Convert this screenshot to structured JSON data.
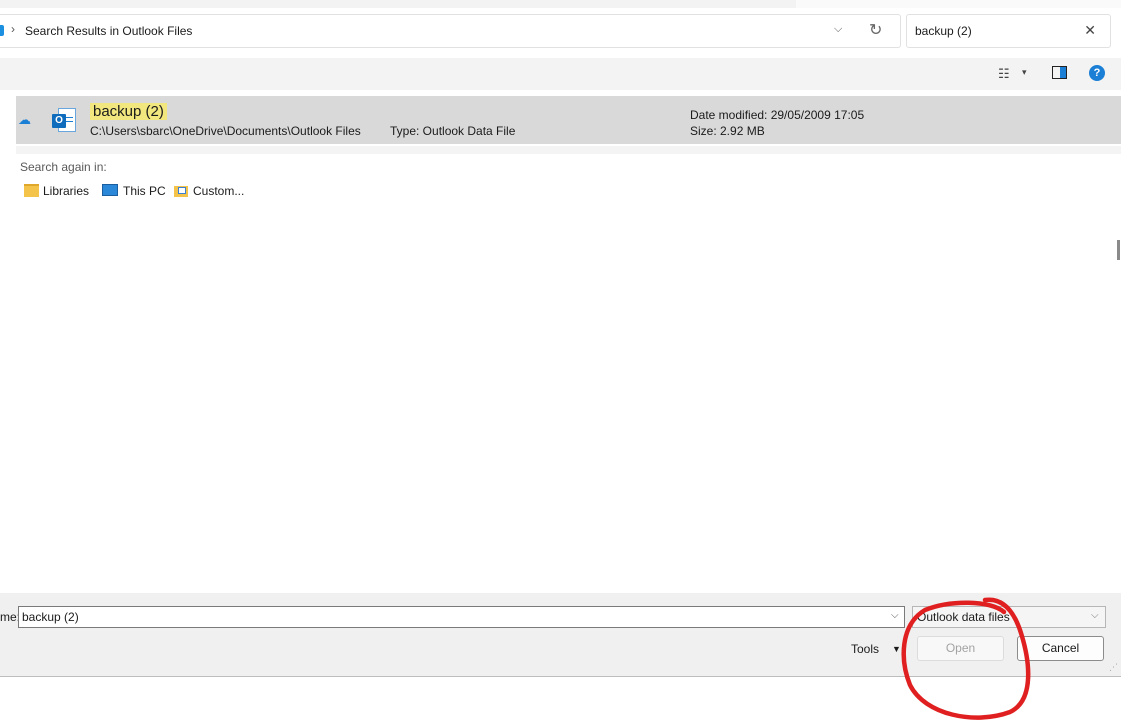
{
  "address": {
    "separator": "›",
    "location": "Search Results in Outlook Files",
    "dropdown_glyph": "⌵",
    "refresh_glyph": "↻"
  },
  "search": {
    "query": "backup (2)",
    "clear_glyph": "✕"
  },
  "toolbar": {
    "view_glyph": "☷",
    "view_dropdown_glyph": "▾",
    "help_glyph": "?"
  },
  "results": [
    {
      "name": "backup (2)",
      "path": "C:\\Users\\sbarc\\OneDrive\\Documents\\Outlook Files",
      "type": "Type: Outlook Data File",
      "date_modified": "Date modified: 29/05/2009 17:05",
      "size": "Size: 2.92 MB",
      "file_badge": "O",
      "cloud_glyph": "☁"
    }
  ],
  "search_again": {
    "label": "Search again in:",
    "locations": [
      "Libraries",
      "This PC",
      "Custom..."
    ]
  },
  "bottom": {
    "filename_label": "me:",
    "filename_value": "backup (2)",
    "dropdown_glyph": "⌵",
    "filter_value": "Outlook data files",
    "tools_label": "Tools",
    "tools_arrow": "▼",
    "open_label": "Open",
    "cancel_label": "Cancel",
    "grip_glyph": "⋰"
  },
  "colors": {
    "selection_bg": "#d9d9d9",
    "highlight": "#f2e77e",
    "annotation_stroke": "#e02020",
    "accent": "#1b7fd6"
  }
}
